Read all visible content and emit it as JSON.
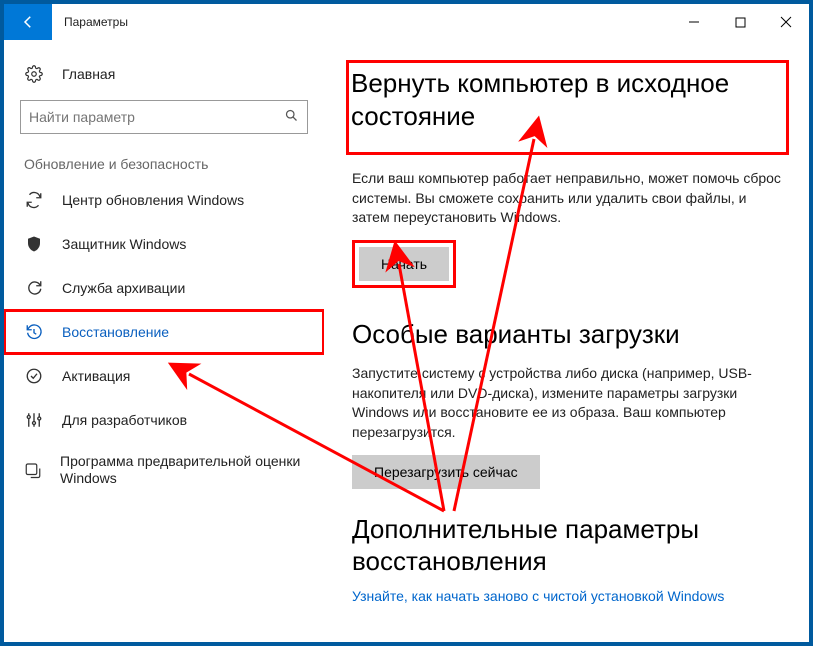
{
  "titlebar": {
    "title": "Параметры"
  },
  "sidebar": {
    "home": "Главная",
    "search_placeholder": "Найти параметр",
    "group": "Обновление и безопасность",
    "items": [
      {
        "label": "Центр обновления Windows"
      },
      {
        "label": "Защитник Windows"
      },
      {
        "label": "Служба архивации"
      },
      {
        "label": "Восстановление"
      },
      {
        "label": "Активация"
      },
      {
        "label": "Для разработчиков"
      },
      {
        "label": "Программа предварительной оценки Windows"
      }
    ]
  },
  "main": {
    "reset": {
      "heading": "Вернуть компьютер в исходное состояние",
      "desc": "Если ваш компьютер работает неправильно, может помочь сброс системы. Вы сможете сохранить или удалить свои файлы, и затем переустановить Windows.",
      "button": "Начать"
    },
    "advanced": {
      "heading": "Особые варианты загрузки",
      "desc": "Запустите систему с устройства либо диска (например, USB-накопителя или DVD-диска), измените параметры загрузки Windows или восстановите ее из образа. Ваш компьютер перезагрузится.",
      "button": "Перезагрузить сейчас"
    },
    "more": {
      "heading": "Дополнительные параметры восстановления",
      "link": "Узнайте, как начать заново с чистой установкой Windows"
    }
  }
}
